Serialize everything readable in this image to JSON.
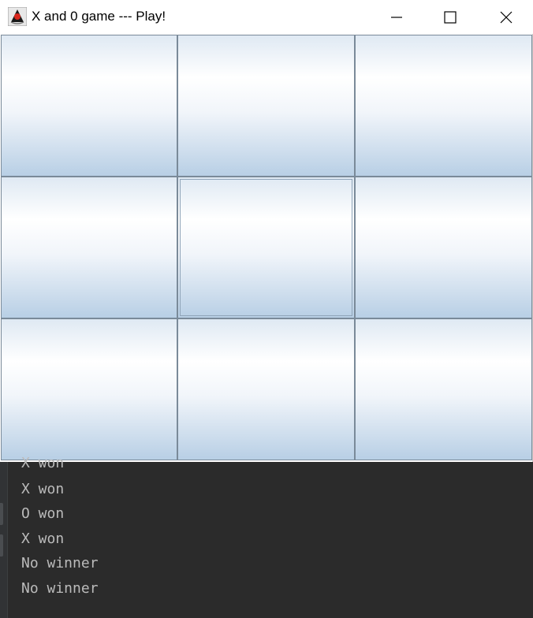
{
  "window": {
    "title": "X and 0 game --- Play!",
    "icon": "java-duke-icon"
  },
  "titlebar_buttons": {
    "minimize": "minimize-icon",
    "maximize": "maximize-icon",
    "close": "close-icon"
  },
  "board": {
    "cells": [
      "",
      "",
      "",
      "",
      "",
      "",
      "",
      "",
      ""
    ],
    "focused_cell": 4
  },
  "console": {
    "lines": [
      "X won",
      "X won",
      "O won",
      "X won",
      "No winner",
      "No winner"
    ]
  },
  "colors": {
    "cell_border": "#7a8a99",
    "cell_gradient_top": "#dfe9f3",
    "cell_gradient_bottom": "#b8cfe5",
    "console_bg": "#2b2b2b",
    "console_text": "#bbbbbb"
  }
}
